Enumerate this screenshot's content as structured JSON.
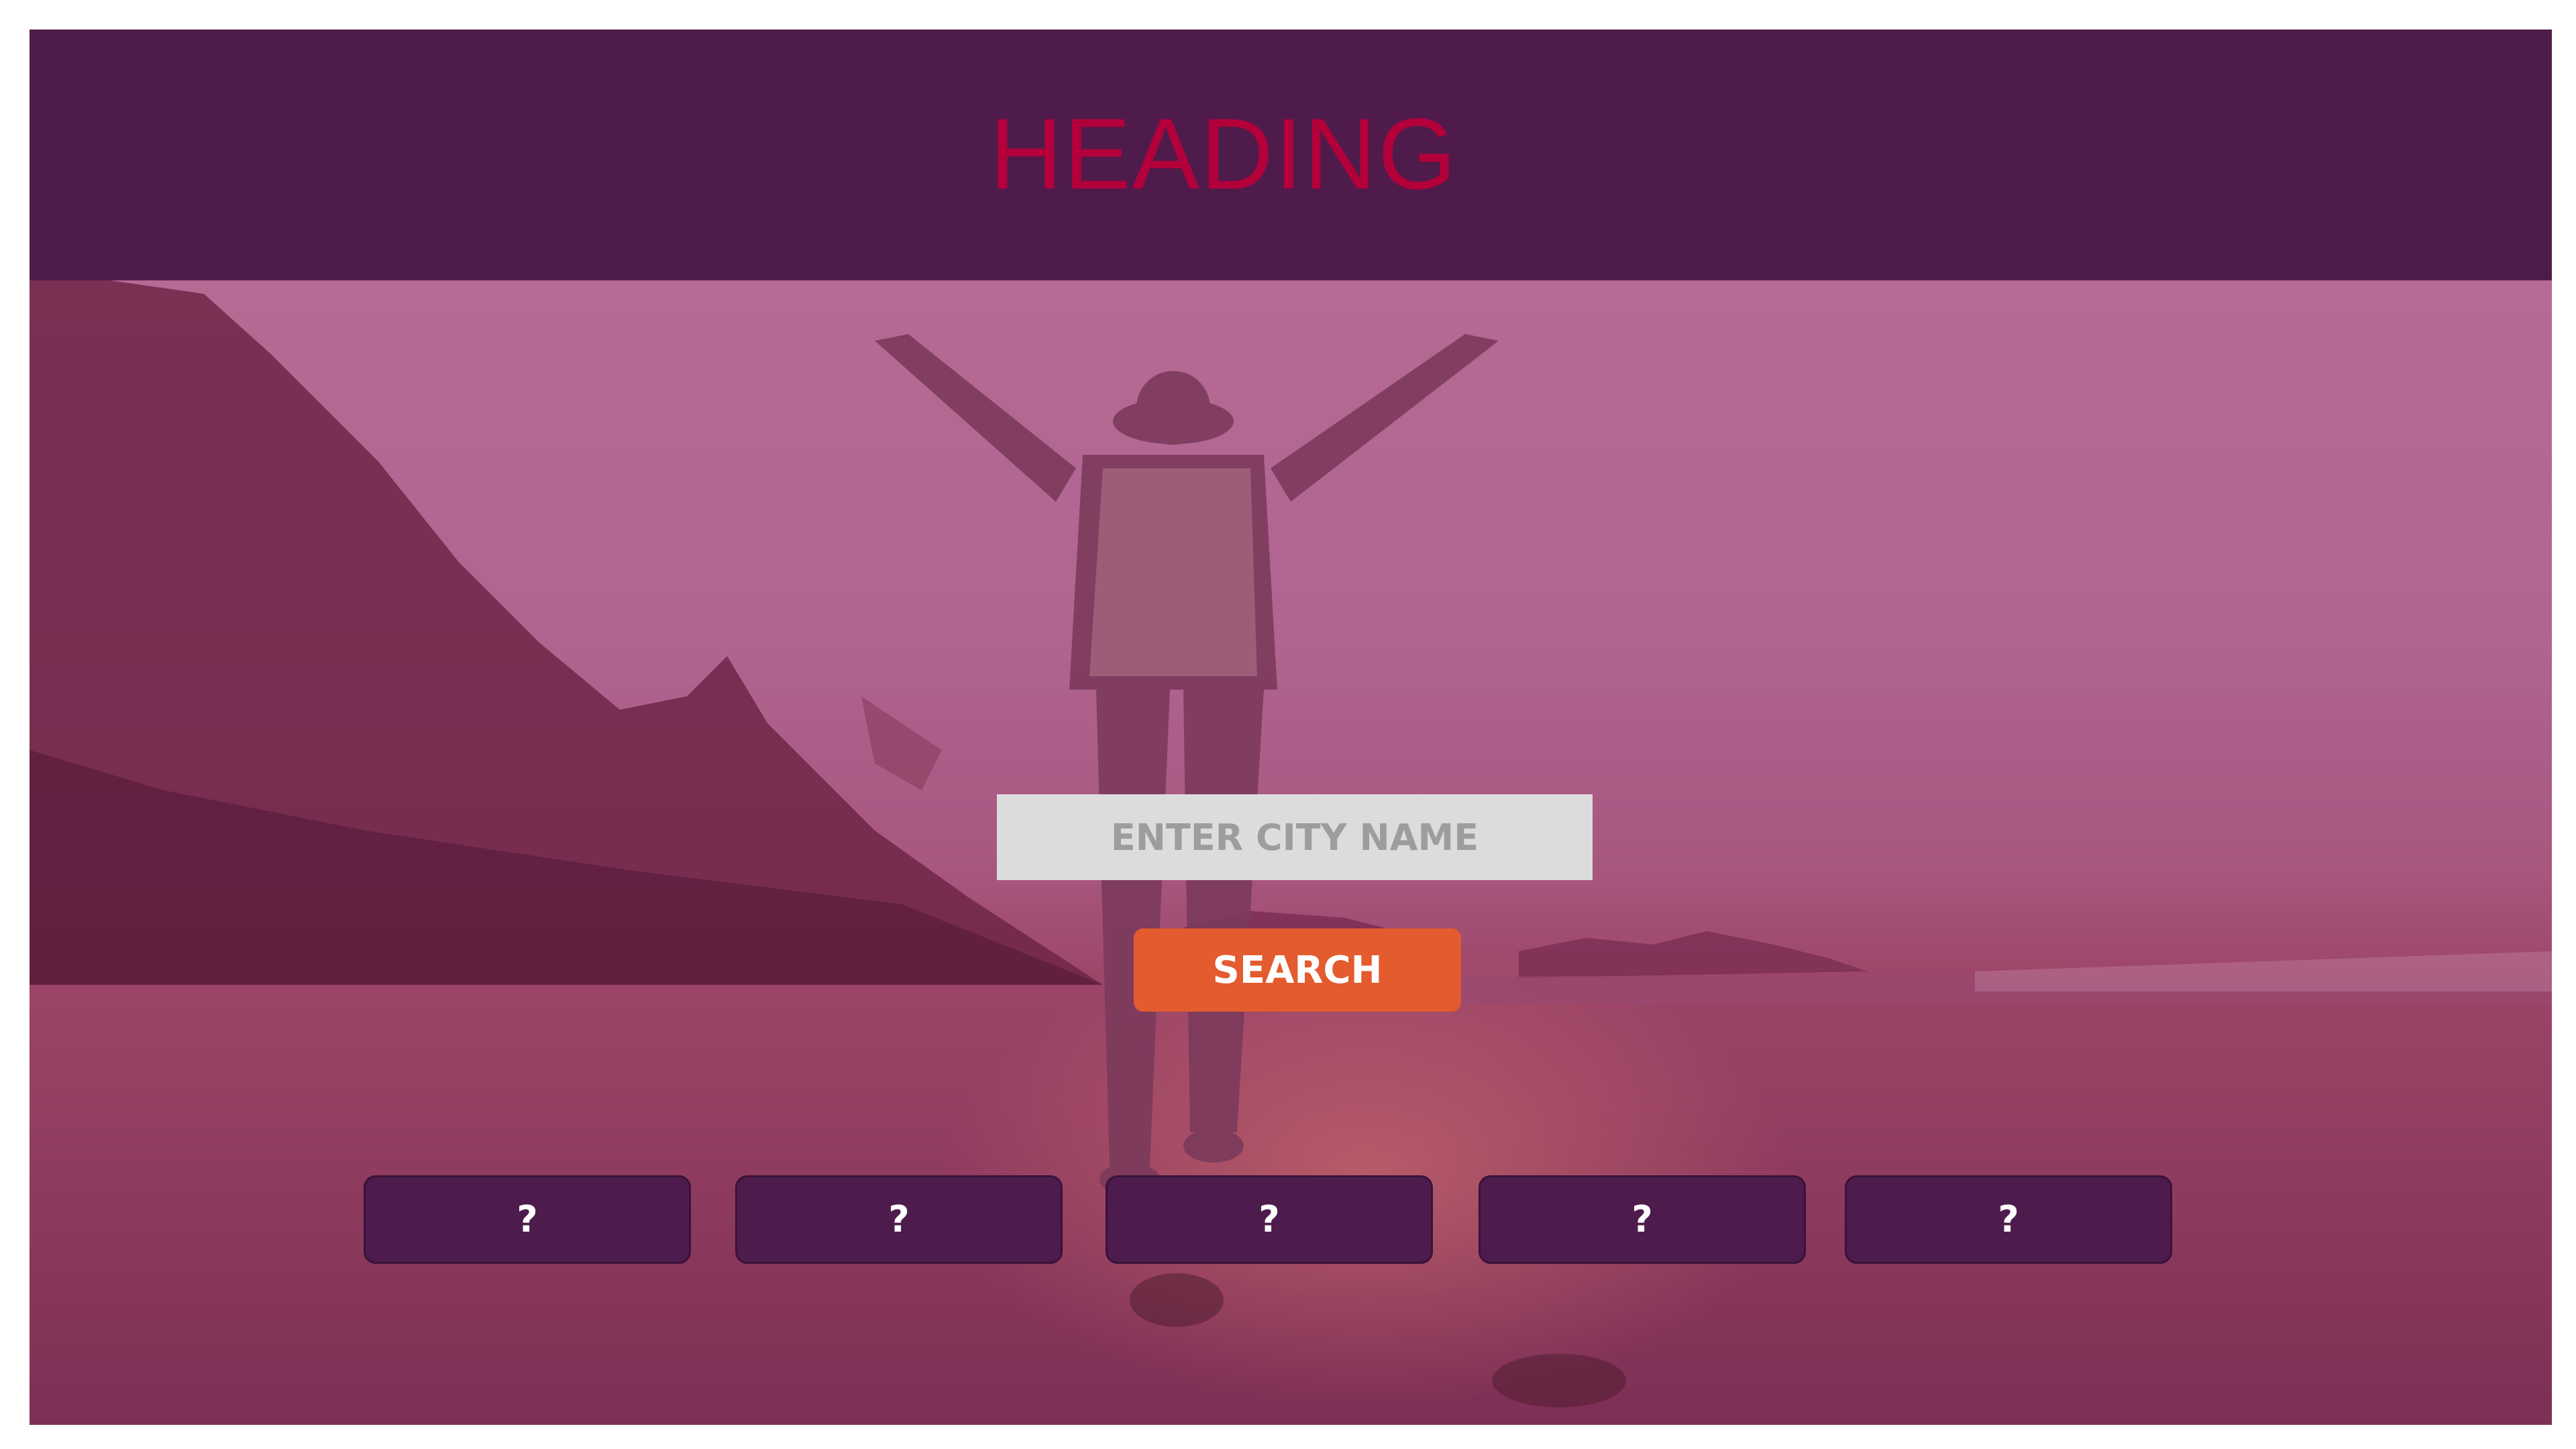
{
  "header": {
    "title": "HEADING"
  },
  "search": {
    "placeholder": "ENTER CITY NAME",
    "value": "",
    "button_label": "SEARCH"
  },
  "results": [
    {
      "label": "?"
    },
    {
      "label": "?"
    },
    {
      "label": "?"
    },
    {
      "label": "?"
    },
    {
      "label": "?"
    }
  ],
  "colors": {
    "header_bg": "#4f1b4a",
    "heading_text": "#b3003b",
    "search_button": "#e35b2e",
    "input_bg": "#dcdcdc",
    "card_bg": "#4d1c4d",
    "overlay_tint": "#a8567e"
  }
}
